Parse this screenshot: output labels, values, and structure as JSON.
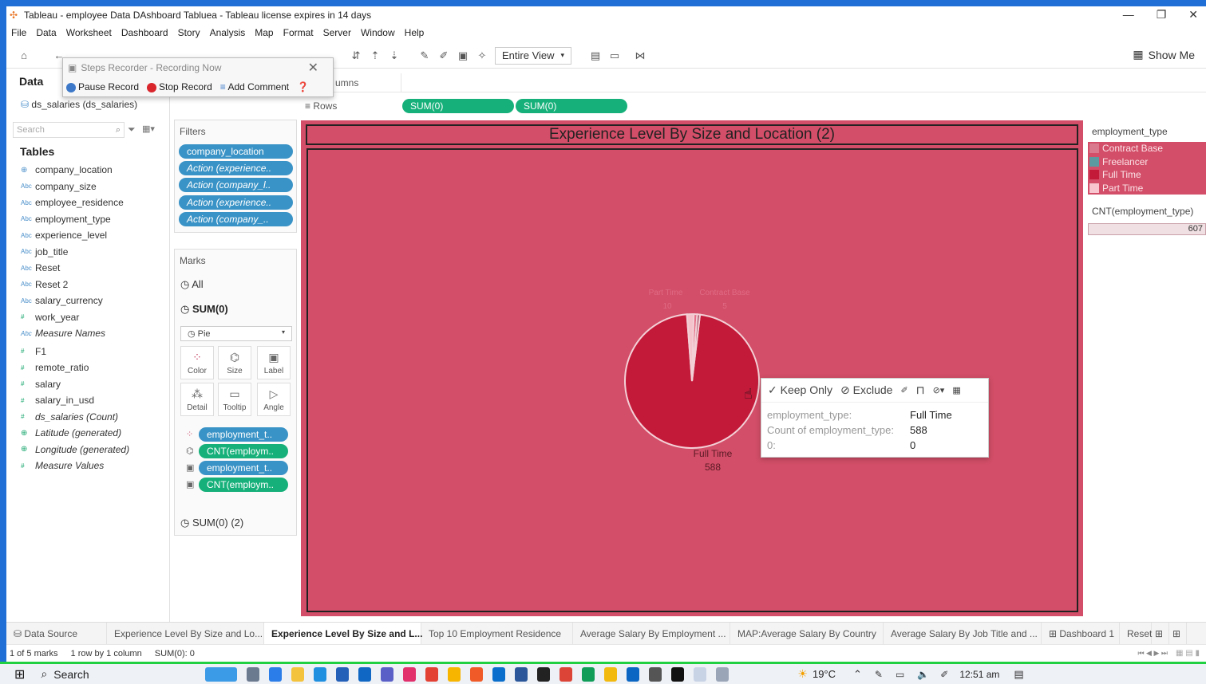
{
  "window": {
    "title": "Tableau - employee Data DAshboard Tabluea - Tableau license expires in 14 days",
    "controls": [
      "—",
      "❐",
      "✕"
    ]
  },
  "menu": [
    "File",
    "Data",
    "Worksheet",
    "Dashboard",
    "Story",
    "Analysis",
    "Map",
    "Format",
    "Server",
    "Window",
    "Help"
  ],
  "toolbar": {
    "view_select": "Entire View",
    "show_me": "Show Me"
  },
  "steps_recorder": {
    "title": "Steps Recorder - Recording Now",
    "pause": "Pause Record",
    "stop": "Stop Record",
    "comment": "Add Comment"
  },
  "data_pane": {
    "title": "Data",
    "datasource": "ds_salaries (ds_salaries)",
    "search_placeholder": "Search",
    "tables_label": "Tables",
    "fields": [
      {
        "type": "geo",
        "name": "company_location"
      },
      {
        "type": "Abc",
        "name": "company_size"
      },
      {
        "type": "Abc",
        "name": "employee_residence"
      },
      {
        "type": "Abc",
        "name": "employment_type"
      },
      {
        "type": "Abc",
        "name": "experience_level"
      },
      {
        "type": "Abc",
        "name": "job_title"
      },
      {
        "type": "Abc",
        "name": "Reset"
      },
      {
        "type": "Abc",
        "name": "Reset 2"
      },
      {
        "type": "Abc",
        "name": "salary_currency"
      },
      {
        "type": "#",
        "name": "work_year"
      },
      {
        "type": "Abc",
        "name": "Measure Names"
      },
      {
        "type": "#",
        "name": "F1"
      },
      {
        "type": "#",
        "name": "remote_ratio"
      },
      {
        "type": "#",
        "name": "salary"
      },
      {
        "type": "#",
        "name": "salary_in_usd"
      },
      {
        "type": "#",
        "name": "ds_salaries (Count)"
      },
      {
        "type": "geo",
        "name": "Latitude (generated)"
      },
      {
        "type": "geo",
        "name": "Longitude (generated)"
      },
      {
        "type": "#",
        "name": "Measure Values"
      }
    ]
  },
  "shelves": {
    "columns_label": "Columns",
    "rows_label": "Rows",
    "rows_pills": [
      "SUM(0)",
      "SUM(0)"
    ],
    "filters_label": "Filters",
    "filters": [
      "company_location",
      "Action (experience..",
      "Action (company_l..",
      "Action (experience..",
      "Action (company_.."
    ],
    "marks_label": "Marks",
    "marks_all": "All",
    "marks_sum": "SUM(0)",
    "mark_type": "Pie",
    "mark_buttons": [
      "Color",
      "Size",
      "Label",
      "Detail",
      "Tooltip",
      "Angle"
    ],
    "mark_pills": [
      "employment_t..",
      "CNT(employm..",
      "employment_t..",
      "CNT(employm.."
    ],
    "marks_sum2": "SUM(0) (2)"
  },
  "viz": {
    "title": "Experience Level By Size and Location (2)",
    "pie_label_main": "Full Time",
    "pie_value_main": "588",
    "faint_labels": [
      "Part Time",
      "Contract Base",
      "10",
      "5"
    ]
  },
  "chart_data": {
    "type": "pie",
    "categories": [
      "Full Time",
      "Part Time",
      "Contract Base",
      "Freelancer"
    ],
    "values": [
      588,
      10,
      5,
      4
    ],
    "colors": [
      "#c31a3a",
      "#f4c2ca",
      "#e56d87",
      "#9e4a5f"
    ],
    "title": "Experience Level By Size and Location (2)"
  },
  "legend": {
    "title": "employment_type",
    "items": [
      {
        "label": "Contract Base",
        "color": "#d97a8e"
      },
      {
        "label": "Freelancer",
        "color": "#5b9aa0"
      },
      {
        "label": "Full Time",
        "color": "#c31a3a"
      },
      {
        "label": "Part Time",
        "color": "#f7c6cf"
      }
    ],
    "size_title": "CNT(employment_type)",
    "size_value": "607"
  },
  "tooltip": {
    "keep_only": "Keep Only",
    "exclude": "Exclude",
    "field1_label": "employment_type:",
    "field1_value": "Full Time",
    "field2_label": "Count of employment_type:",
    "field2_value": "588",
    "field3_label": "0:",
    "field3_value": "0"
  },
  "tabs": [
    "Data Source",
    "Experience Level By Size and Lo...",
    "Experience Level By Size and L...",
    "Top 10 Employment Residence",
    "Average Salary By Employment ...",
    "MAP:Average Salary By Country",
    "Average Salary By Job Title and ...",
    "Dashboard 1",
    "Reset"
  ],
  "status": {
    "marks": "1 of 5 marks",
    "rows": "1 row by 1 column",
    "sum": "SUM(0): 0"
  },
  "taskbar": {
    "search": "Search",
    "temp": "19°C",
    "time": "12:51 am"
  }
}
